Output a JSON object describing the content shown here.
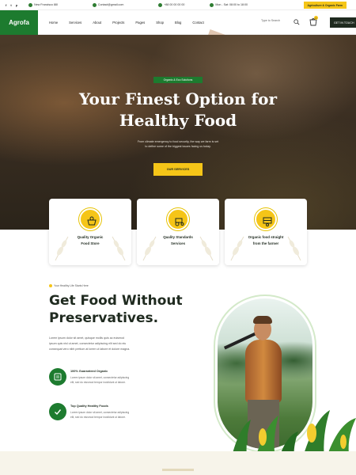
{
  "topbar": {
    "social": [
      "f",
      "t",
      "p",
      "in"
    ],
    "address": "New Francisco 88I",
    "email": "Contact@gmail.com",
    "phone": "+88 00 00 00 00",
    "hours": "Mon - Sat: 08:00 to 18:00",
    "cta_label": "Agriculture & Organic Farm"
  },
  "nav": {
    "logo": "Agrofa",
    "menu": [
      "Home",
      "Services",
      "About",
      "Projects",
      "Pages",
      "Shop",
      "Blog",
      "Contact"
    ],
    "search_placeholder": "Type to Search",
    "cart_count": "0",
    "get_button": "GET IN TOUCH"
  },
  "hero": {
    "tag": "Organic & Eco Solutions",
    "title_line1": "Your Finest Option for",
    "title_line2": "Healthy Food",
    "subtitle_line1": "From climate emergency to food security, the way we farm is set",
    "subtitle_line2": "to define some of the biggest issues facing us today.",
    "button": "OUR SERVICES"
  },
  "features": [
    {
      "title_line1": "Quality Organic",
      "title_line2": "Food Store"
    },
    {
      "title_line1": "Quality Standards",
      "title_line2": "Services"
    },
    {
      "title_line1": "Organic food straight",
      "title_line2": "from the farmer"
    }
  ],
  "about": {
    "tag": "Your Healthy Life Starts Here",
    "heading_line1": "Get Food Without",
    "heading_line2": "Preservatives.",
    "para_line1": "Lorem ipsum dolor sit amet, quisque mollis quis ac euismod",
    "para_line2": "ipsum quis nisl ut amet, consectetur adipiscing elit sed do eiu",
    "para_line3": "consequat vero nibh pretium at lorem ut labore et dolore magna.",
    "items": [
      {
        "title": "100% Guaranteed Organic",
        "desc_line1": "Lorem ipsum dolor sit amet, consectetur adipiscing",
        "desc_line2": "elit, sed do eiusmod tempor incididunt ut labore."
      },
      {
        "title": "Top Quality Healthy Foods",
        "desc_line1": "Lorem ipsum dolor sit amet, consectetur adipiscing",
        "desc_line2": "elit, sed do eiusmod tempor incididunt ut labore."
      }
    ]
  },
  "colors": {
    "brand_green": "#1d7b2f",
    "accent_yellow": "#f5c518",
    "dark": "#1f2a1f"
  }
}
